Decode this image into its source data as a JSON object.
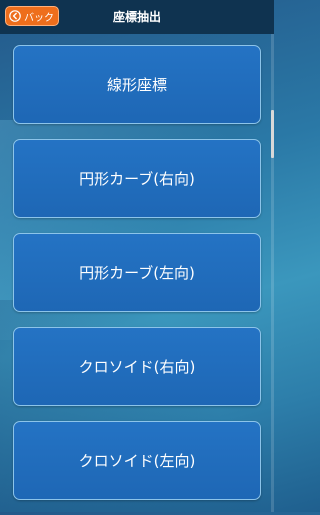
{
  "header": {
    "title": "座標抽出",
    "back_label": "バック",
    "back_icon": "back-arrow-circle-icon"
  },
  "menu": {
    "items": [
      {
        "label": "線形座標"
      },
      {
        "label": "円形カーブ(右向)"
      },
      {
        "label": "円形カーブ(左向)"
      },
      {
        "label": "クロソイド(右向)"
      },
      {
        "label": "クロソイド(左向)"
      }
    ]
  },
  "colors": {
    "header_bg": "#0f3350",
    "back_button": "#ee6e1c",
    "menu_button": "#2170c0",
    "menu_border": "#8cc4ea"
  }
}
